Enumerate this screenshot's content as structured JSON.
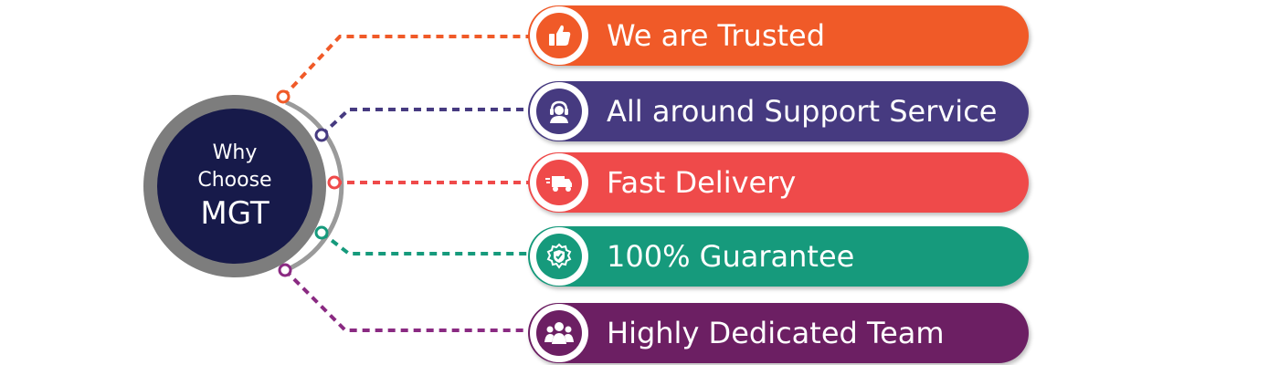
{
  "hub": {
    "line1": "Why",
    "line2": "Choose",
    "line3": "MGT"
  },
  "items": [
    {
      "label": "We are Trusted",
      "color": "#f05a28",
      "icon": "thumbs-up-icon"
    },
    {
      "label": "All around Support Service",
      "color": "#463a80",
      "icon": "support-agent-icon"
    },
    {
      "label": "Fast Delivery",
      "color": "#ef4a4a",
      "icon": "delivery-truck-icon"
    },
    {
      "label": "100% Guarantee",
      "color": "#169a7c",
      "icon": "guarantee-badge-icon"
    },
    {
      "label": "Highly Dedicated Team",
      "color": "#6c1f63",
      "icon": "team-icon"
    }
  ]
}
